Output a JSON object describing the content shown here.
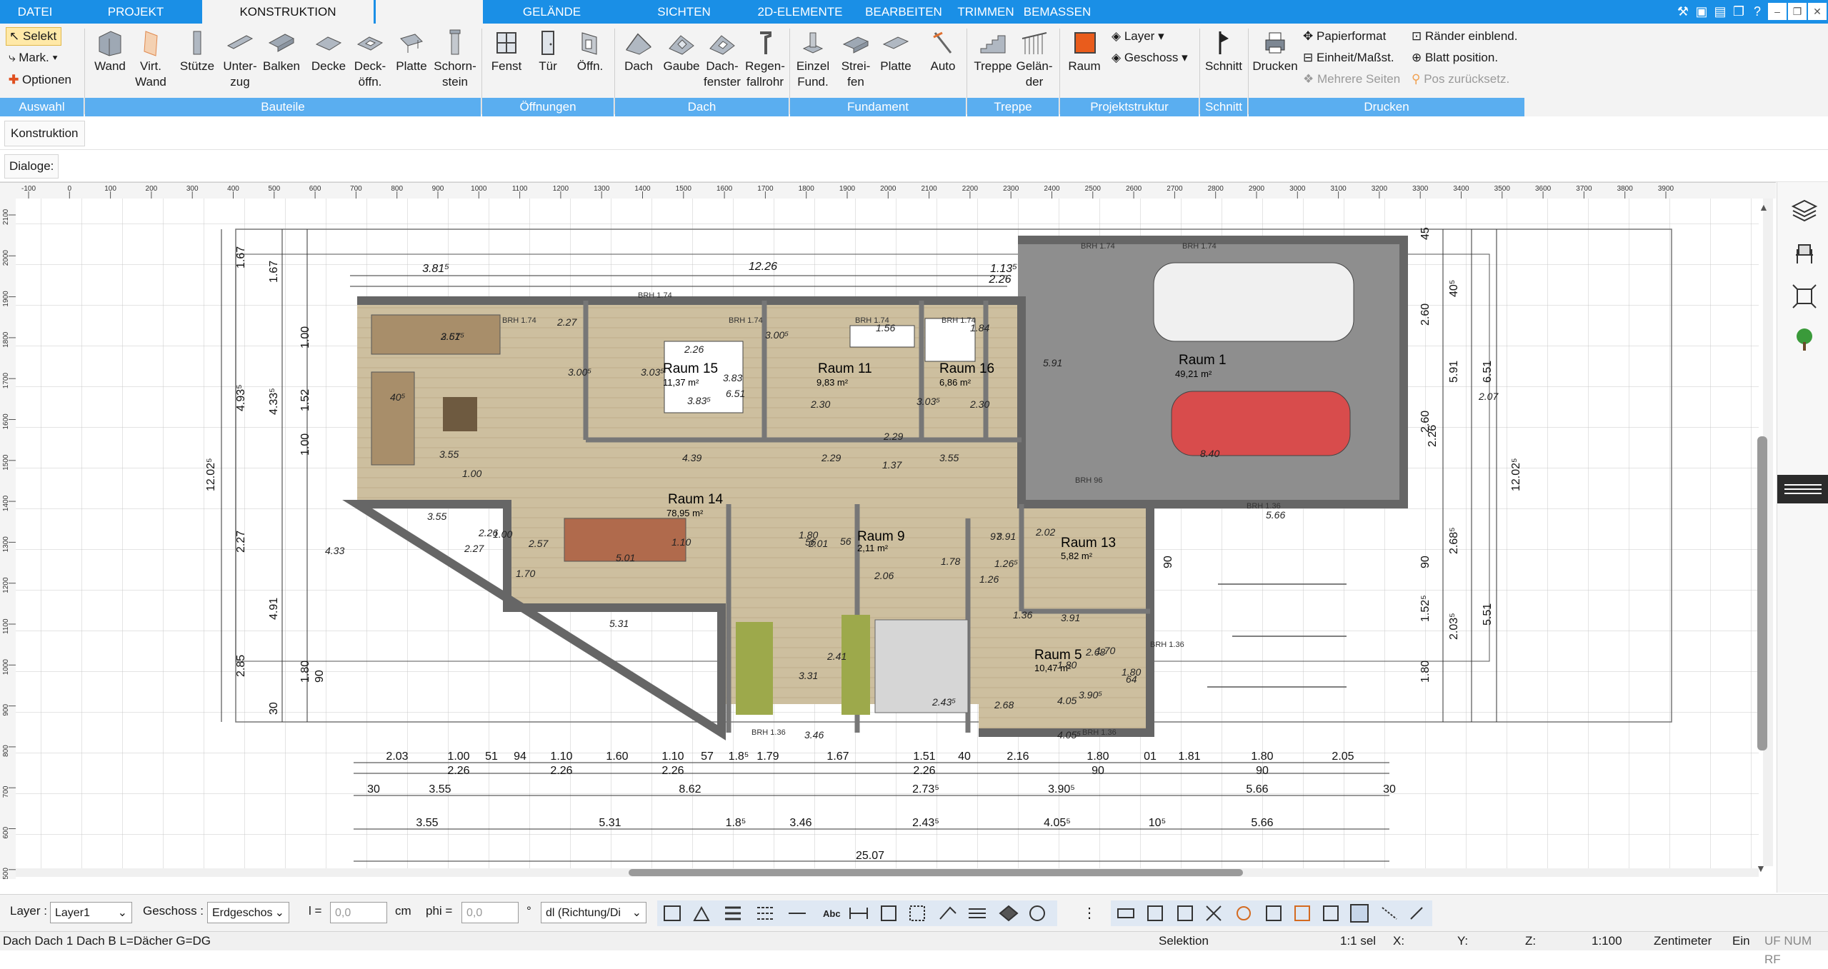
{
  "tabs": [
    "DATEI",
    "PROJEKT",
    "KONSTRUKTION",
    "",
    "GELÄNDE",
    "SICHTEN",
    "2D-ELEMENTE",
    "BEARBEITEN",
    "TRIMMEN",
    "BEMASSEN"
  ],
  "auswahl": {
    "selekt": "Selekt",
    "mark": "Mark.",
    "optionen": "Optionen",
    "group": "Auswahl"
  },
  "bauteile": {
    "items": [
      [
        "Wand",
        ""
      ],
      [
        "Virt.",
        "Wand"
      ],
      [
        "Stütze",
        ""
      ],
      [
        "Unter-",
        "zug"
      ],
      [
        "Balken",
        ""
      ],
      [
        "Decke",
        ""
      ],
      [
        "Deck-",
        "öffn."
      ],
      [
        "Platte",
        ""
      ],
      [
        "Schorn-",
        "stein"
      ]
    ],
    "group": "Bauteile"
  },
  "oeffnungen": {
    "items": [
      [
        "Fenst",
        ""
      ],
      [
        "Tür",
        ""
      ],
      [
        "Öffn.",
        ""
      ]
    ],
    "group": "Öffnungen"
  },
  "dach": {
    "items": [
      [
        "Dach",
        ""
      ],
      [
        "Gaube",
        ""
      ],
      [
        "Dach-",
        "fenster"
      ],
      [
        "Regen-",
        "fallrohr"
      ]
    ],
    "group": "Dach"
  },
  "fundament": {
    "items": [
      [
        "Einzel",
        "Fund."
      ],
      [
        "Strei-",
        "fen"
      ],
      [
        "Platte",
        ""
      ]
    ],
    "group": "Fundament"
  },
  "auto": {
    "label": "Auto"
  },
  "treppe": {
    "items": [
      [
        "Treppe",
        ""
      ],
      [
        "Gelän-",
        "der"
      ]
    ],
    "group": "Treppe"
  },
  "projektstruktur": {
    "raum": "Raum",
    "layer": "Layer",
    "geschoss": "Geschoss",
    "group": "Projektstruktur"
  },
  "schnitt": {
    "label": "Schnitt",
    "group": "Schnitt"
  },
  "drucken": {
    "label": "Drucken",
    "papierformat": "Papierformat",
    "einheit": "Einheit/Maßst.",
    "mehrere": "Mehrere Seiten",
    "raender": "Ränder einblend.",
    "blatt": "Blatt position.",
    "pos": "Pos zurücksetz.",
    "group": "Drucken"
  },
  "panel": {
    "konstruktion": "Konstruktion",
    "dialoge": "Dialoge:"
  },
  "ruler_top": [
    "-100",
    "0",
    "100",
    "200",
    "300",
    "400",
    "500",
    "600",
    "700",
    "800",
    "900",
    "1000",
    "1100",
    "1200",
    "1300",
    "1400",
    "1500",
    "1600",
    "1700",
    "1800",
    "1900",
    "2000",
    "2100",
    "2200",
    "2300",
    "2400",
    "2500",
    "2600",
    "2700",
    "2800",
    "2900",
    "3000",
    "3100",
    "3200",
    "3300",
    "3400",
    "3500",
    "3600",
    "3700",
    "3800",
    "3900"
  ],
  "ruler_left": [
    "2100",
    "2000",
    "1900",
    "1800",
    "1700",
    "1600",
    "1500",
    "1400",
    "1300",
    "1200",
    "1100",
    "1000",
    "900",
    "800",
    "700",
    "600",
    "500"
  ],
  "plan": {
    "rooms": [
      {
        "name": "Raum 1",
        "area": "49,21 m²"
      },
      {
        "name": "Raum 15",
        "area": "11,37 m²"
      },
      {
        "name": "Raum 11",
        "area": "9,83 m²"
      },
      {
        "name": "Raum 16",
        "area": "6,86 m²"
      },
      {
        "name": "Raum 14",
        "area": "78,95 m²"
      },
      {
        "name": "Raum 9",
        "area": "2,11 m²"
      },
      {
        "name": "Raum 13",
        "area": "5,82 m²"
      },
      {
        "name": "Raum 5",
        "area": "10,47 m²"
      }
    ],
    "brh": [
      "BRH 1.74",
      "BRH 1.74",
      "BRH 1.74",
      "BRH 1.74",
      "BRH 1.74",
      "BRH 1.74",
      "BRH 1.74",
      "BRH 96",
      "BRH 1.36",
      "BRH 1.36",
      "BRH 1.36",
      "BRH 1.36"
    ],
    "dim_top": [
      "3.81⁵",
      "12.26",
      "1.13⁵",
      "2.26"
    ],
    "dim_row1": [
      "2.03",
      "1.00",
      "51",
      "94",
      "1.10",
      "1.60",
      "1.10",
      "57",
      "1.8⁵",
      "1.79",
      "1.67",
      "1.51",
      "40",
      "2.16",
      "1.80",
      "01",
      "1.81",
      "1.80",
      "2.05"
    ],
    "dim_row1b": [
      "2.26",
      "2.26",
      "2.26",
      "2.26",
      "90",
      "90"
    ],
    "dim_row2": [
      "30",
      "3.55",
      "8.62",
      "2.73⁵",
      "3.90⁵",
      "5.66",
      "30"
    ],
    "dim_row3": [
      "3.55",
      "5.31",
      "1.8⁵",
      "3.46",
      "2.43⁵",
      "4.05⁵",
      "10⁵",
      "5.66"
    ],
    "dim_total": "25.07",
    "dim_left": [
      "1.67",
      "1.67",
      "12.02⁵",
      "4.93⁵",
      "4.33⁵",
      "2.27",
      "4.91",
      "2.85",
      "30",
      "1.00",
      "1.52",
      "1.00",
      "1.80",
      "90"
    ],
    "dim_right": [
      "12.02⁵",
      "6.51",
      "5.91",
      "5.51",
      "2.26",
      "2.68⁵",
      "2.03⁵",
      "1.80",
      "1.52⁵",
      "45",
      "40⁵",
      "2.60",
      "2.60",
      "90",
      "90"
    ],
    "dim_inner": [
      "3.61⁵",
      "2.27",
      "3.00⁵",
      "3.55",
      "3.55",
      "4.39",
      "2.29",
      "1.37",
      "3.55",
      "5.01",
      "5.31",
      "3.31",
      "2.41",
      "3.46",
      "2.43⁵",
      "4.05⁵",
      "3.91",
      "2.68",
      "1.80",
      "5.66",
      "5.91",
      "8.40",
      "2.26",
      "1.00",
      "2.57",
      "2.27",
      "1.00",
      "2.26",
      "3.83⁵",
      "3.83",
      "3.03⁵",
      "3.00⁵",
      "1.56",
      "1.84",
      "2.30",
      "2.30",
      "2.29",
      "56",
      "2.01",
      "2.02",
      "3.91",
      "1.26⁵",
      "2.07",
      "6.51",
      "3.03⁵",
      "40⁵",
      "4.33",
      "1.80",
      "1.10",
      "2.06",
      "56",
      "97",
      "1.26",
      "1.70",
      "2.68",
      "64",
      "1.80",
      "3.90⁵",
      "4.05",
      "1.36",
      "1.78",
      "1.70",
      "2.57"
    ]
  },
  "status": {
    "layer_label": "Layer :",
    "layer_value": "Layer1",
    "geschoss_label": "Geschoss :",
    "geschoss_value": "Erdgeschos",
    "l_label": "l =",
    "l_value": "0,0",
    "cm": "cm",
    "phi_label": "phi =",
    "phi_value": "0,0",
    "deg": "°",
    "dl_value": "dl (Richtung/Di",
    "bottom_left": "Dach Dach 1 Dach B L=Dächer G=DG",
    "selektion": "Selektion",
    "sel": "1:1 sel",
    "x": "X:",
    "y": "Y:",
    "z": "Z:",
    "scale": "1:100",
    "unit": "Zentimeter",
    "ein": "Ein",
    "flags": "UF  NUM  RF"
  },
  "colors": {
    "accent": "#1a8fe6",
    "group": "#5aaef0",
    "floor": "#c8b99a",
    "wall": "#6b6b6b",
    "garage": "#8e8e8e"
  }
}
